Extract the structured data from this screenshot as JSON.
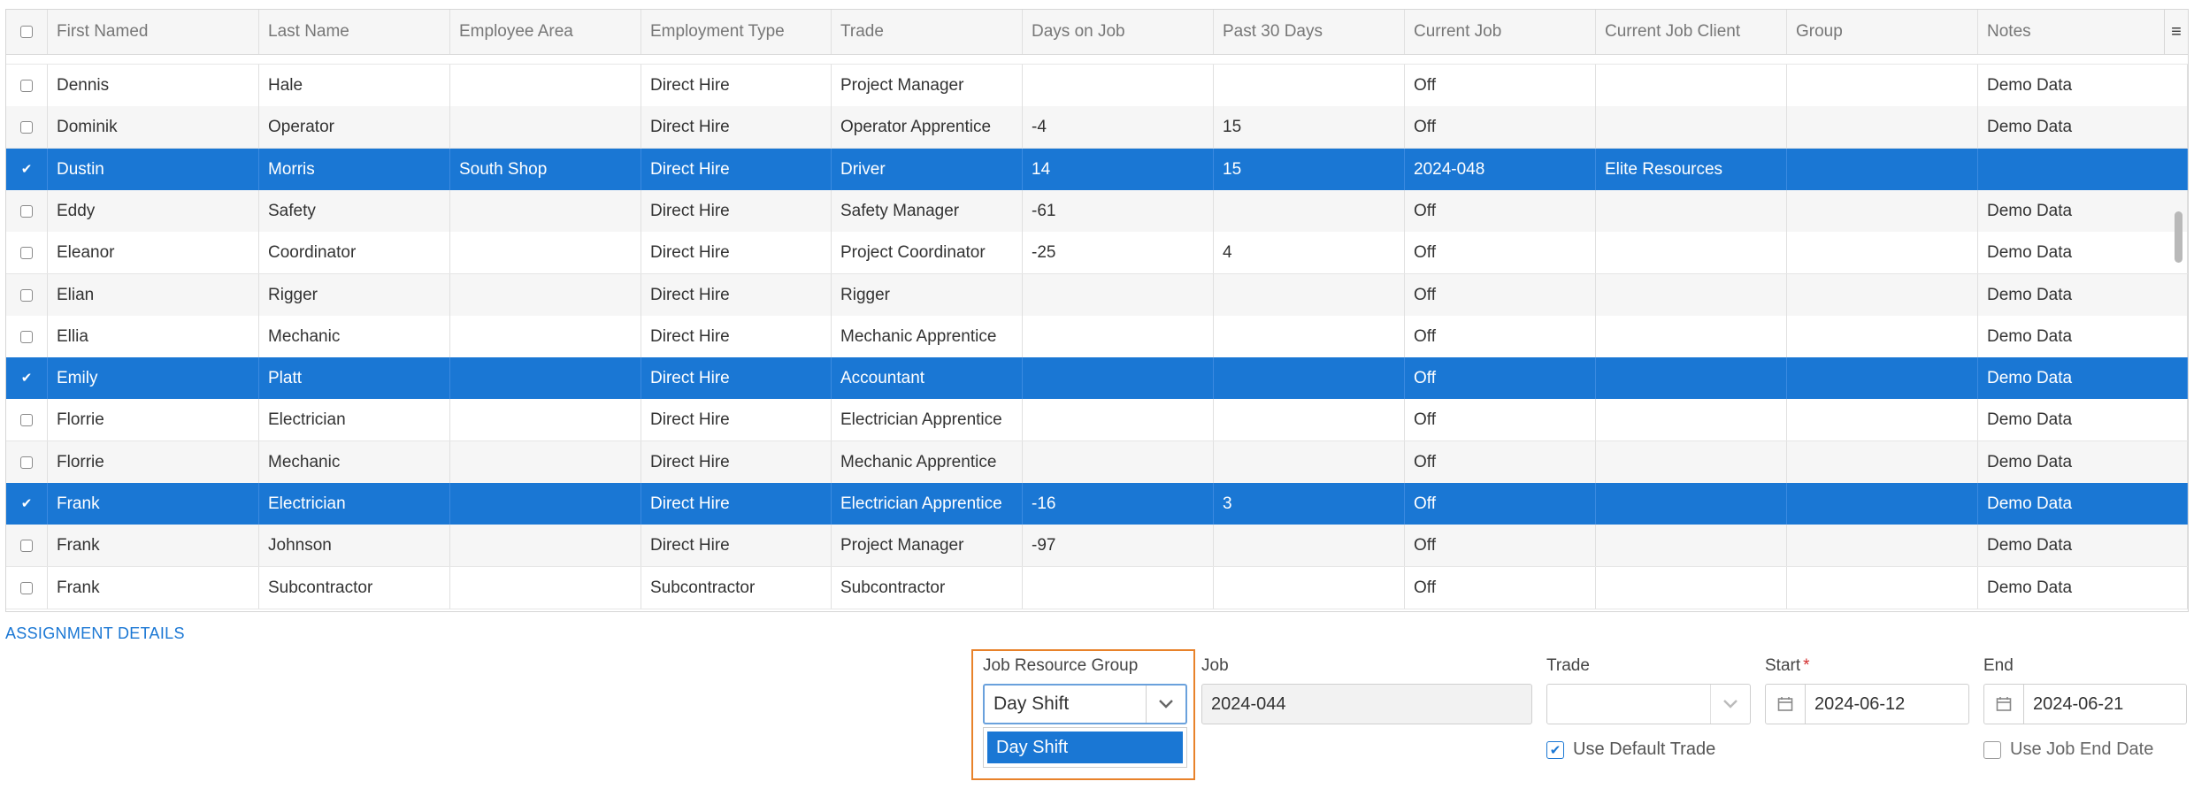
{
  "grid": {
    "columns": [
      "First Named",
      "Last Name",
      "Employee Area",
      "Employment Type",
      "Trade",
      "Days on Job",
      "Past 30 Days",
      "Current Job",
      "Current Job Client",
      "Group",
      "Notes"
    ],
    "rows": [
      {
        "selected": false,
        "cells": [
          "Dennis",
          "Hale",
          "",
          "Direct Hire",
          "Project Manager",
          "",
          "",
          "Off",
          "",
          "",
          "Demo Data"
        ]
      },
      {
        "selected": false,
        "cells": [
          "Dominik",
          "Operator",
          "",
          "Direct Hire",
          "Operator Apprentice",
          "-4",
          "15",
          "Off",
          "",
          "",
          "Demo Data"
        ]
      },
      {
        "selected": true,
        "cells": [
          "Dustin",
          "Morris",
          "South Shop",
          "Direct Hire",
          "Driver",
          "14",
          "15",
          "2024-048",
          "Elite Resources",
          "",
          ""
        ]
      },
      {
        "selected": false,
        "cells": [
          "Eddy",
          "Safety",
          "",
          "Direct Hire",
          "Safety Manager",
          "-61",
          "",
          "Off",
          "",
          "",
          "Demo Data"
        ]
      },
      {
        "selected": false,
        "cells": [
          "Eleanor",
          "Coordinator",
          "",
          "Direct Hire",
          "Project Coordinator",
          "-25",
          "4",
          "Off",
          "",
          "",
          "Demo Data"
        ]
      },
      {
        "selected": false,
        "cells": [
          "Elian",
          "Rigger",
          "",
          "Direct Hire",
          "Rigger",
          "",
          "",
          "Off",
          "",
          "",
          "Demo Data"
        ]
      },
      {
        "selected": false,
        "cells": [
          "Ellia",
          "Mechanic",
          "",
          "Direct Hire",
          "Mechanic Apprentice",
          "",
          "",
          "Off",
          "",
          "",
          "Demo Data"
        ]
      },
      {
        "selected": true,
        "cells": [
          "Emily",
          "Platt",
          "",
          "Direct Hire",
          "Accountant",
          "",
          "",
          "Off",
          "",
          "",
          "Demo Data"
        ]
      },
      {
        "selected": false,
        "cells": [
          "Florrie",
          "Electrician",
          "",
          "Direct Hire",
          "Electrician Apprentice",
          "",
          "",
          "Off",
          "",
          "",
          "Demo Data"
        ]
      },
      {
        "selected": false,
        "cells": [
          "Florrie",
          "Mechanic",
          "",
          "Direct Hire",
          "Mechanic Apprentice",
          "",
          "",
          "Off",
          "",
          "",
          "Demo Data"
        ]
      },
      {
        "selected": true,
        "cells": [
          "Frank",
          "Electrician",
          "",
          "Direct Hire",
          "Electrician Apprentice",
          "-16",
          "3",
          "Off",
          "",
          "",
          "Demo Data"
        ]
      },
      {
        "selected": false,
        "cells": [
          "Frank",
          "Johnson",
          "",
          "Direct Hire",
          "Project Manager",
          "-97",
          "",
          "Off",
          "",
          "",
          "Demo Data"
        ]
      },
      {
        "selected": false,
        "cells": [
          "Frank",
          "Subcontractor",
          "",
          "Subcontractor",
          "Subcontractor",
          "",
          "",
          "Off",
          "",
          "",
          "Demo Data"
        ]
      }
    ]
  },
  "assignment": {
    "section_label": "ASSIGNMENT DETAILS",
    "job_resource_group_label": "Job Resource Group",
    "job_resource_group_value": "Day Shift",
    "dropdown_option": "Day Shift",
    "job_label": "Job",
    "job_value": "2024-044",
    "trade_label": "Trade",
    "trade_value": "",
    "use_default_trade_label": "Use Default Trade",
    "use_default_trade_checked": true,
    "start_label": "Start",
    "start_required": "*",
    "start_value": "2024-06-12",
    "end_label": "End",
    "end_value": "2024-06-21",
    "use_job_end_date_label": "Use Job End Date",
    "use_job_end_date_checked": false
  },
  "icons": {
    "check": "✔",
    "chevron_down": "⌄",
    "calendar": "▦",
    "menu": "≡"
  },
  "colors": {
    "selection": "#1a77d4",
    "highlight_border": "#e8822a"
  }
}
